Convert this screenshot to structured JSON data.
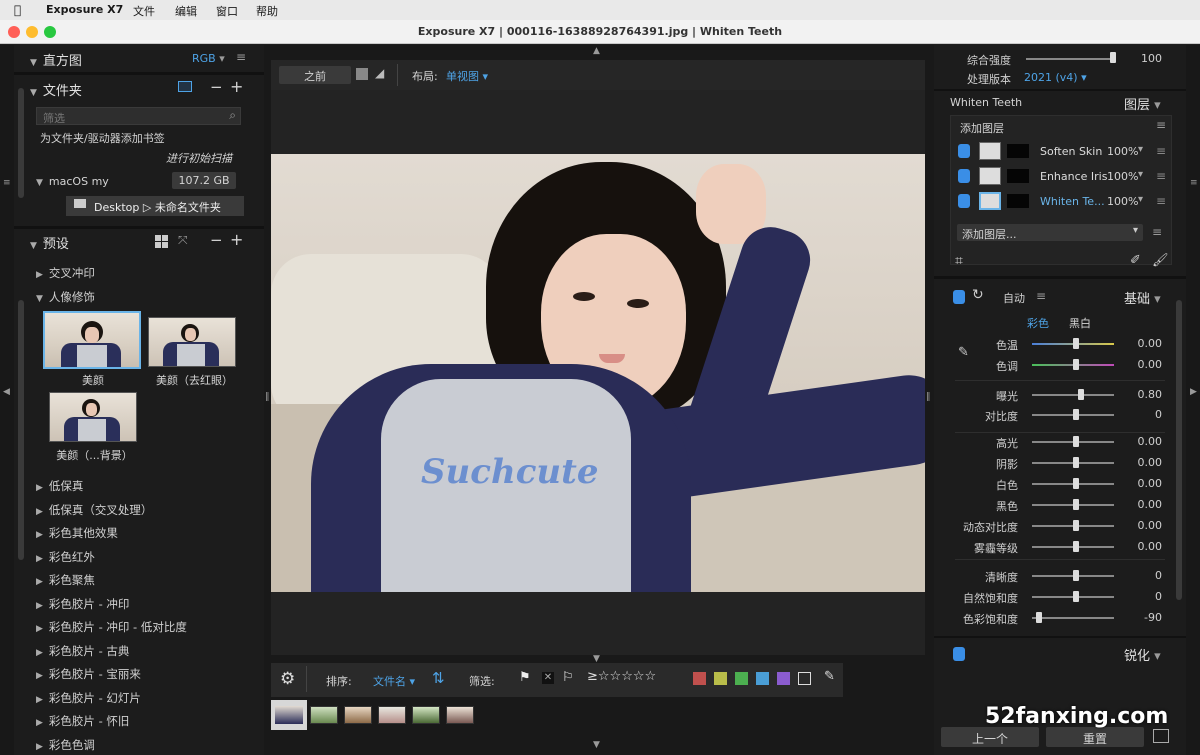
{
  "menubar": {
    "app": "Exposure X7",
    "file": "文件",
    "edit": "编辑",
    "window": "窗口",
    "help": "帮助"
  },
  "window_title": "Exposure X7 | 000116-16388928764391.jpg | Whiten Teeth",
  "left": {
    "histogram": "直方图",
    "rgb": "RGB",
    "folders": "文件夹",
    "filter_placeholder": "筛选",
    "bookmark_hint": "为文件夹/驱动器添加书签",
    "scan": "进行初始扫描",
    "drive": "macOS my",
    "drive_size": "107.2 GB",
    "folder_path": "Desktop ▷ 未命名文件夹",
    "presets": "预设",
    "preset_groups_top": [
      "交叉冲印",
      "人像修饰"
    ],
    "thumbs": [
      "美颜",
      "美颜（去红眼）",
      "美颜（...背景）"
    ],
    "preset_groups": [
      "低保真",
      "低保真（交叉处理）",
      "彩色其他效果",
      "彩色红外",
      "彩色聚焦",
      "彩色胶片 - 冲印",
      "彩色胶片 - 冲印 - 低对比度",
      "彩色胶片 - 古典",
      "彩色胶片 - 宝丽来",
      "彩色胶片 - 幻灯片",
      "彩色胶片 - 怀旧",
      "彩色色调"
    ]
  },
  "toolbar": {
    "before": "之前",
    "layout_label": "布局:",
    "layout_value": "单视图"
  },
  "bottom": {
    "sort_label": "排序:",
    "sort_value": "文件名",
    "filter_label": "筛选:",
    "stars": "≥☆☆☆☆☆",
    "color_labels": [
      "#c0504d",
      "#b9bd4a",
      "#4caf50",
      "#4a9ed6",
      "#8b5ccf"
    ]
  },
  "right": {
    "overall": "综合强度",
    "overall_val": "100",
    "version_label": "处理版本",
    "version": "2021 (v4)",
    "preset_name": "Whiten Teeth",
    "layers": "图层",
    "add_layer": "添加图层",
    "layer_list": [
      {
        "name": "Soften Skin",
        "pct": "100%"
      },
      {
        "name": "Enhance Iris",
        "pct": "100%"
      },
      {
        "name": "Whiten Te...",
        "pct": "100%"
      }
    ],
    "add_layer_dd": "添加图层...",
    "auto": "自动",
    "basic": "基础",
    "color_tab": "彩色",
    "bw_tab": "黑白",
    "adjust": [
      {
        "label": "色温",
        "val": "0.00"
      },
      {
        "label": "色调",
        "val": "0.00"
      },
      {
        "label": "曝光",
        "val": "0.80"
      },
      {
        "label": "对比度",
        "val": "0"
      },
      {
        "label": "高光",
        "val": "0.00"
      },
      {
        "label": "阴影",
        "val": "0.00"
      },
      {
        "label": "白色",
        "val": "0.00"
      },
      {
        "label": "黑色",
        "val": "0.00"
      },
      {
        "label": "动态对比度",
        "val": "0.00"
      },
      {
        "label": "雾霾等级",
        "val": "0.00"
      },
      {
        "label": "清晰度",
        "val": "0"
      },
      {
        "label": "自然饱和度",
        "val": "0"
      },
      {
        "label": "色彩饱和度",
        "val": "-90"
      }
    ],
    "sharpen": "锐化",
    "prev": "上一个",
    "reset": "重置"
  },
  "watermark": "52fanxing.com"
}
